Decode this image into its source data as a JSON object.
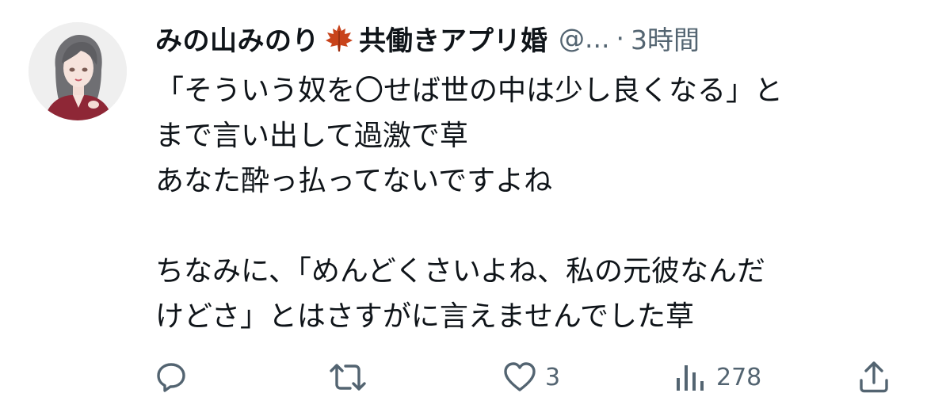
{
  "author": {
    "display_name": "みの山みのり",
    "name_suffix": "共働きアプリ婚",
    "handle": "@...",
    "separator": "·",
    "time": "3時間"
  },
  "tweet": {
    "lines": [
      "「そういう奴を〇せば世の中は少し良くなる」と",
      "まで言い出して過激で草",
      "あなた酔っ払ってないですよね",
      "",
      "ちなみに、「めんどくさいよね、私の元彼なんだ",
      "けどさ」とはさすがに言えませんでした草"
    ]
  },
  "actions": {
    "reply_count": "",
    "retweet_count": "",
    "like_count": "3",
    "views_count": "278"
  },
  "icons": {
    "name_emoji": "maple-leaf-icon",
    "reply": "reply-icon",
    "retweet": "retweet-icon",
    "like": "heart-icon",
    "views": "views-icon",
    "share": "share-icon"
  },
  "colors": {
    "text": "#0f1419",
    "secondary": "#536471",
    "maple": "#c8431b"
  }
}
